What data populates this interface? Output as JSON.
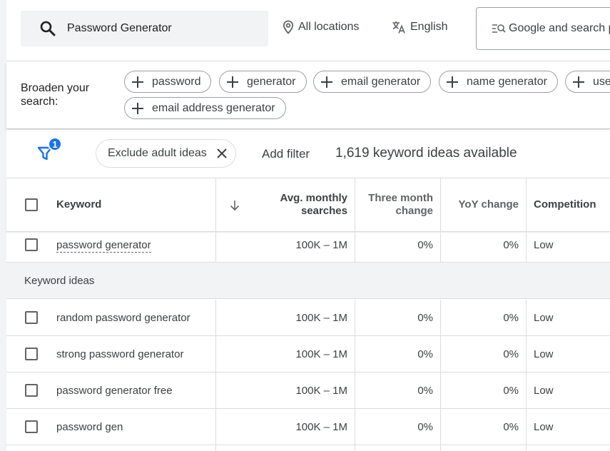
{
  "search": {
    "query": "Password Generator"
  },
  "location": {
    "label": "All locations"
  },
  "language": {
    "label": "English"
  },
  "network": {
    "label": "Google and search partners"
  },
  "broaden": {
    "label": "Broaden your search:",
    "chips": [
      "password",
      "generator",
      "email generator",
      "name generator",
      "user",
      "email address generator"
    ]
  },
  "filters": {
    "badge_count": "1",
    "exclude_chip": "Exclude adult ideas",
    "add_filter": "Add filter",
    "ideas_available": "1,619 keyword ideas available"
  },
  "table": {
    "headers": {
      "keyword": "Keyword",
      "avg_monthly": "Avg. monthly searches",
      "three_month": "Three month change",
      "yoy": "YoY change",
      "competition": "Competition"
    },
    "provided": {
      "keyword": "password generator",
      "avg": "100K – 1M",
      "three": "0%",
      "yoy": "0%",
      "competition": "Low"
    },
    "section_label": "Keyword ideas",
    "rows": [
      {
        "keyword": "random password generator",
        "avg": "100K – 1M",
        "three": "0%",
        "yoy": "0%",
        "competition": "Low"
      },
      {
        "keyword": "strong password generator",
        "avg": "100K – 1M",
        "three": "0%",
        "yoy": "0%",
        "competition": "Low"
      },
      {
        "keyword": "password generator free",
        "avg": "100K – 1M",
        "three": "0%",
        "yoy": "0%",
        "competition": "Low"
      },
      {
        "keyword": "password gen",
        "avg": "100K – 1M",
        "three": "0%",
        "yoy": "0%",
        "competition": "Low"
      }
    ]
  },
  "colors": {
    "accent": "#1a73e8",
    "text": "#3c4043",
    "border": "#dadce0",
    "section_bg": "#f1f3f4"
  }
}
